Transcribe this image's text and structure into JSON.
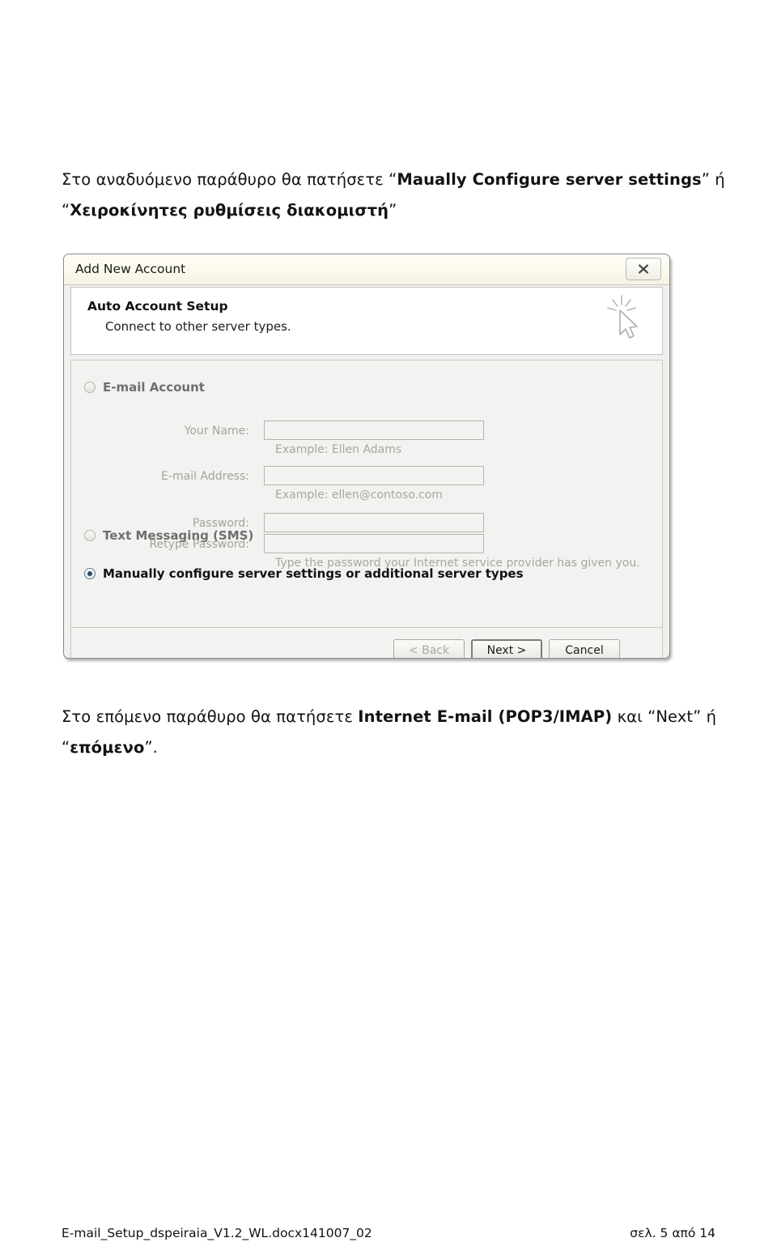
{
  "document": {
    "paragraph_top": {
      "segments": [
        {
          "text": "Στο αναδυόμενο παράθυρο θα πατήσετε “",
          "bold": false
        },
        {
          "text": "Maually Configure server settings",
          "bold": true
        },
        {
          "text": "” ή “",
          "bold": false
        },
        {
          "text": "Χειροκίνητες ρυθμίσεις διακομιστή",
          "bold": true
        },
        {
          "text": "”",
          "bold": false
        }
      ]
    },
    "paragraph_bottom": {
      "segments": [
        {
          "text": "Στο επόμενο παράθυρο θα πατήσετε ",
          "bold": false
        },
        {
          "text": "Internet E-mail (POP3/IMAP)",
          "bold": true
        },
        {
          "text": " και “Next” ή “",
          "bold": false
        },
        {
          "text": "επόμενο",
          "bold": true
        },
        {
          "text": "”.",
          "bold": false
        }
      ]
    },
    "footer": {
      "filename": "E-mail_Setup_dspeiraia_V1.2_WL.docx141007_02",
      "page_label": "σελ. 5 από 14"
    }
  },
  "dialog": {
    "title": "Add New Account",
    "close_icon": "close-icon",
    "header": {
      "title": "Auto Account Setup",
      "subtitle": "Connect to other server types.",
      "badge_icon": "sparkle-cursor-icon"
    },
    "options": [
      {
        "id": "email-account",
        "label": "E-mail Account",
        "selected": false,
        "enabled": false
      },
      {
        "id": "text-messaging",
        "label": "Text Messaging (SMS)",
        "selected": false,
        "enabled": false
      },
      {
        "id": "manual-config",
        "label": "Manually configure server settings or additional server types",
        "selected": true,
        "enabled": true
      }
    ],
    "fields": [
      {
        "id": "your-name",
        "label": "Your Name:",
        "value": "",
        "hint": "Example: Ellen Adams"
      },
      {
        "id": "email-address",
        "label": "E-mail Address:",
        "value": "",
        "hint": "Example: ellen@contoso.com"
      },
      {
        "id": "password",
        "label": "Password:",
        "value": "",
        "hint": ""
      },
      {
        "id": "retype-password",
        "label": "Retype Password:",
        "value": "",
        "hint": "Type the password your Internet service provider has given you."
      }
    ],
    "buttons": [
      {
        "id": "back",
        "label": "< Back",
        "enabled": false,
        "default": false
      },
      {
        "id": "next",
        "label": "Next >",
        "enabled": true,
        "default": true
      },
      {
        "id": "cancel",
        "label": "Cancel",
        "enabled": true,
        "default": false
      }
    ]
  },
  "colors": {
    "dialog_background": "#f1f0ee",
    "titlebar": "#fbf9ec",
    "border": "#8a8a86",
    "radio_selected": "#2b4c68",
    "disabled_text": "#a4a29c"
  }
}
